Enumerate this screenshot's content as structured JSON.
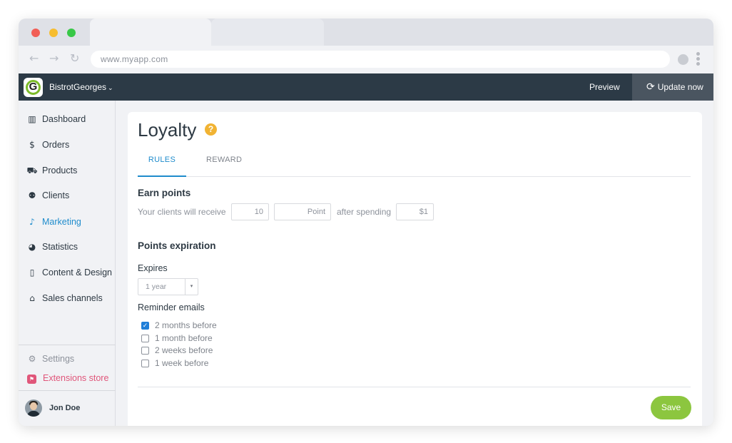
{
  "browser": {
    "url": "www.myapp.com",
    "back_icon": "arrow-left-icon",
    "forward_icon": "arrow-right-icon",
    "reload_icon": "reload-icon"
  },
  "header": {
    "logo_letter": "G",
    "store_name": "BistrotGeorges",
    "store_chevron": "⌄",
    "preview_label": "Preview",
    "update_label": "Update now",
    "update_icon": "⟳"
  },
  "sidebar": {
    "items": [
      {
        "icon": "bar-chart-icon",
        "glyph": "▥",
        "label": "Dashboard"
      },
      {
        "icon": "dollar-icon",
        "glyph": "$",
        "label": "Orders"
      },
      {
        "icon": "cart-icon",
        "glyph": "⛟",
        "label": "Products"
      },
      {
        "icon": "people-icon",
        "glyph": "⚉",
        "label": "Clients"
      },
      {
        "icon": "bell-icon",
        "glyph": "♪",
        "label": "Marketing",
        "active": true
      },
      {
        "icon": "pie-chart-icon",
        "glyph": "◕",
        "label": "Statistics"
      },
      {
        "icon": "phone-icon",
        "glyph": "▯",
        "label": "Content & Design"
      },
      {
        "icon": "store-icon",
        "glyph": "⌂",
        "label": "Sales channels"
      }
    ],
    "settings_label": "Settings",
    "settings_glyph": "⚙",
    "extensions_label": "Extensions store",
    "extensions_glyph": "⚑",
    "user_name": "Jon Doe"
  },
  "page": {
    "title": "Loyalty",
    "help_glyph": "?",
    "tabs": [
      "RULES",
      "REWARD"
    ],
    "active_tab": "RULES",
    "earn": {
      "heading": "Earn points",
      "prefix": "Your clients will receive",
      "points_value": "10",
      "unit_value": "Point",
      "middle": "after spending",
      "spend_value": "$1"
    },
    "expiration": {
      "heading": "Points expiration",
      "expires_label": "Expires",
      "expires_value": "1 year",
      "select_caret": "▾",
      "reminder_label": "Reminder emails",
      "options": [
        {
          "label": "2 months before",
          "checked": true
        },
        {
          "label": "1 month before",
          "checked": false
        },
        {
          "label": "2 weeks before",
          "checked": false
        },
        {
          "label": "1 week before",
          "checked": false
        }
      ],
      "check_glyph": "✓"
    },
    "save_label": "Save"
  },
  "colors": {
    "accent": "#1f8ccc",
    "header_bg": "#2c3a46",
    "save_bg": "#8cc63f",
    "extensions": "#e0567a",
    "help": "#f1b333"
  }
}
